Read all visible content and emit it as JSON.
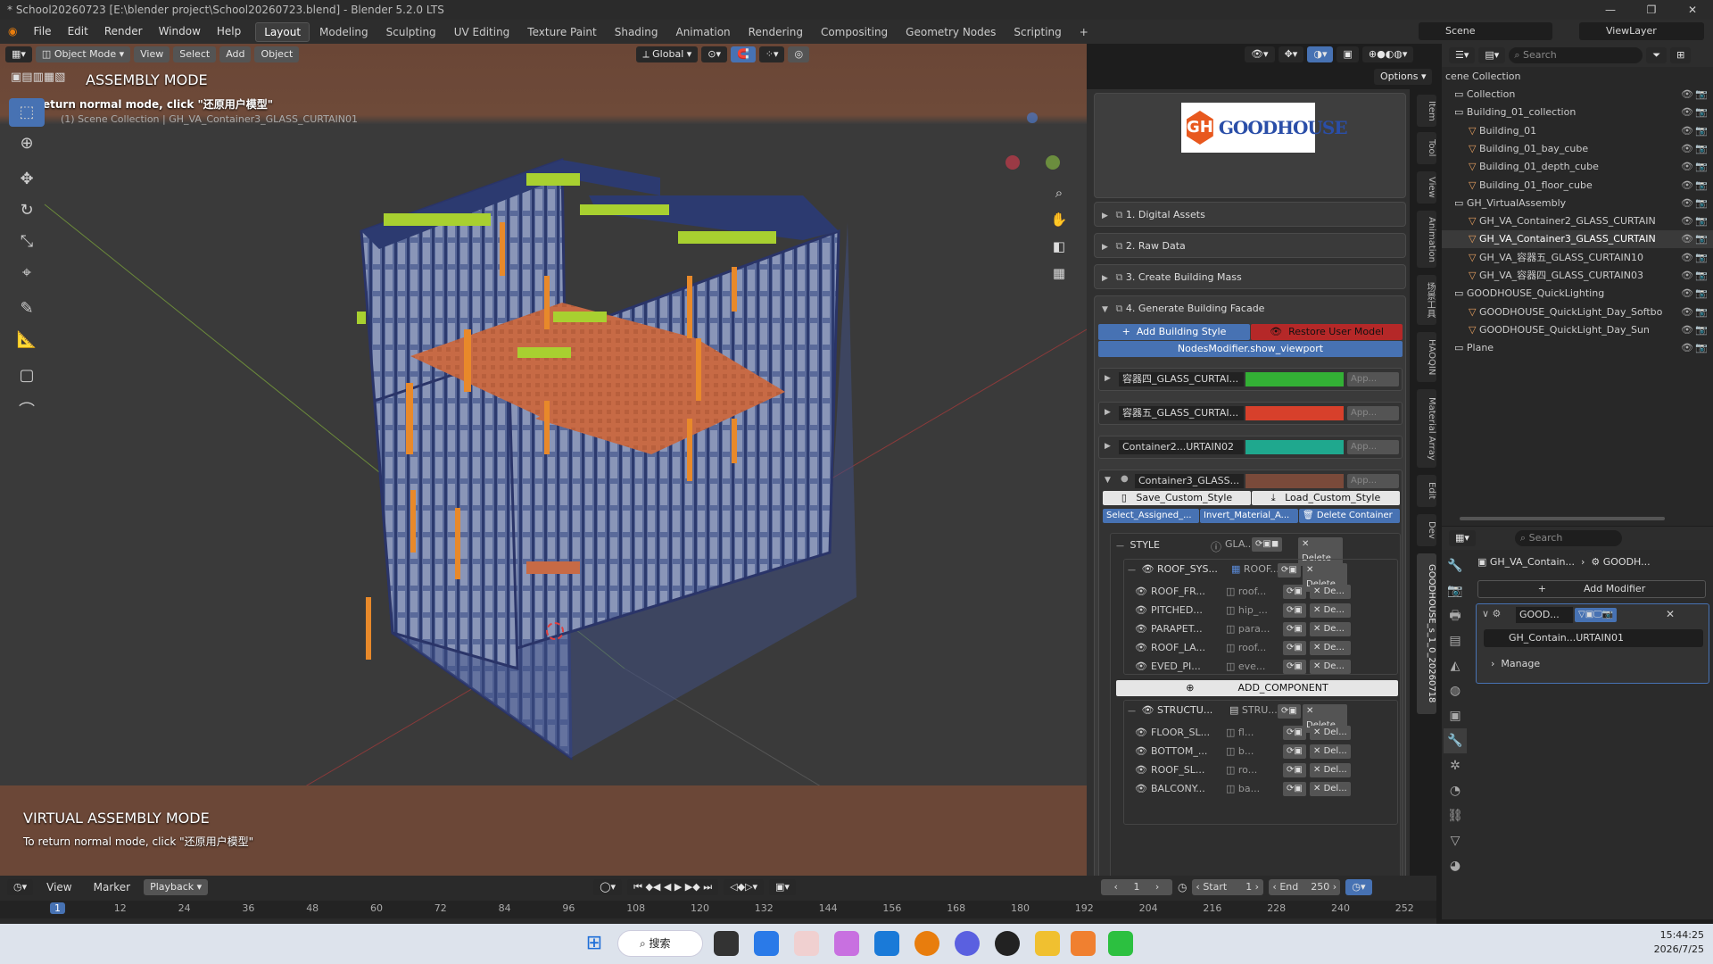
{
  "window": {
    "title": "* School20260723 [E:\\blender project\\School20260723.blend] - Blender 5.2.0 LTS"
  },
  "menu": [
    "File",
    "Edit",
    "Render",
    "Window",
    "Help"
  ],
  "workspaces": [
    "Layout",
    "Modeling",
    "Sculpting",
    "UV Editing",
    "Texture Paint",
    "Shading",
    "Animation",
    "Rendering",
    "Compositing",
    "Geometry Nodes",
    "Scripting"
  ],
  "scene": {
    "name": "Scene",
    "viewlayer": "ViewLayer",
    "search_placeholder": "Search"
  },
  "viewport": {
    "mode": "Object Mode",
    "menus": [
      "View",
      "Select",
      "Add",
      "Object"
    ],
    "transform": "Global",
    "options": "Options",
    "top_heading": "ASSEMBLY MODE",
    "top_hint": "eturn normal mode, click  \"还原用户模型\"",
    "collection_path": "(1) Scene Collection | GH_VA_Container3_GLASS_CURTAIN01",
    "bottom_heading": "VIRTUAL ASSEMBLY MODE",
    "bottom_hint": "To return normal mode, click  \"还原用户模型\""
  },
  "side_tabs": [
    "Item",
    "Tool",
    "View",
    "Animation",
    "场景工具",
    "HAOQIN",
    "Material Array",
    "Edit",
    "Dev",
    "GOODHOUSE_s_1_0_20260718"
  ],
  "goodhouse": {
    "logo_text": "GOODHOUSE",
    "logo_mark": "GH",
    "sections": [
      "1. Digital Assets",
      "2. Raw Data",
      "3. Create Building Mass",
      "4. Generate Building Facade"
    ],
    "add_style": "Add Building Style",
    "restore": "Restore User Model",
    "nodes_modifier": "NodesModifier.show_viewport",
    "containers": [
      {
        "name": "容器四_GLASS_CURTAI...",
        "color": "#33b035",
        "apply": "App..."
      },
      {
        "name": "容器五_GLASS_CURTAI...",
        "color": "#d7402b",
        "apply": "App..."
      },
      {
        "name": "Container2...URTAIN02",
        "color": "#1fa88e",
        "apply": "App..."
      },
      {
        "name": "Container3_GLASS...",
        "color": "#7a4a3a",
        "apply": "App..."
      }
    ],
    "save_style": "Save_Custom_Style",
    "load_style": "Load_Custom_Style",
    "select_assigned": "Select_Assigned_...",
    "invert_material": "Invert_Material_A...",
    "delete_container": "Delete Container",
    "style_label": "STYLE",
    "style_value": "GLA...",
    "delete": "Delete",
    "roof_sys": "ROOF_SYS...",
    "roof_sys_value": "ROOF...",
    "roof_items": [
      {
        "name": "ROOF_FR...",
        "value": "roof...",
        "del": "De..."
      },
      {
        "name": "PITCHED...",
        "value": "hip_...",
        "del": "De..."
      },
      {
        "name": "PARAPET...",
        "value": "para...",
        "del": "De..."
      },
      {
        "name": "ROOF_LA...",
        "value": "roof...",
        "del": "De..."
      },
      {
        "name": "EVED_PI...",
        "value": "eve...",
        "del": "De..."
      }
    ],
    "add_component": "ADD_COMPONENT",
    "structure": "STRUCTU...",
    "structure_value": "STRU...",
    "struct_items": [
      {
        "name": "FLOOR_SL...",
        "value": "fl...",
        "del": "Del..."
      },
      {
        "name": "BOTTOM_...",
        "value": "b...",
        "del": "Del..."
      },
      {
        "name": "ROOF_SL...",
        "value": "ro...",
        "del": "Del..."
      },
      {
        "name": "BALCONY...",
        "value": "ba...",
        "del": "Del..."
      }
    ]
  },
  "outliner": {
    "root": "cene Collection",
    "rows": [
      {
        "label": "Collection",
        "indent": 0
      },
      {
        "label": "Building_01_collection",
        "indent": 0
      },
      {
        "label": "Building_01",
        "indent": 1
      },
      {
        "label": "Building_01_bay_cube",
        "indent": 1
      },
      {
        "label": "Building_01_depth_cube",
        "indent": 1
      },
      {
        "label": "Building_01_floor_cube",
        "indent": 1
      },
      {
        "label": "GH_VirtualAssembly",
        "indent": 0
      },
      {
        "label": "GH_VA_Container2_GLASS_CURTAIN",
        "indent": 1
      },
      {
        "label": "GH_VA_Container3_GLASS_CURTAIN",
        "indent": 1
      },
      {
        "label": "GH_VA_容器五_GLASS_CURTAIN10",
        "indent": 1
      },
      {
        "label": "GH_VA_容器四_GLASS_CURTAIN03",
        "indent": 1
      },
      {
        "label": "GOODHOUSE_QuickLighting",
        "indent": 0
      },
      {
        "label": "GOODHOUSE_QuickLight_Day_Softbo",
        "indent": 1
      },
      {
        "label": "GOODHOUSE_QuickLight_Day_Sun",
        "indent": 1
      },
      {
        "label": "Plane",
        "indent": 0
      }
    ]
  },
  "properties": {
    "search_placeholder": "Search",
    "object": "GH_VA_Contain...",
    "modifier_owner": "GOODH...",
    "add_modifier": "Add Modifier",
    "modifier_name": "GOOD...",
    "node_group": "GH_Contain...URTAIN01",
    "manage": "Manage"
  },
  "timeline": {
    "menus": [
      "View",
      "Marker",
      "Playback"
    ],
    "current_frame": "1",
    "start_label": "Start",
    "start": "1",
    "end_label": "End",
    "end": "250",
    "ticks": [
      "1",
      "12",
      "24",
      "36",
      "48",
      "60",
      "72",
      "84",
      "96",
      "108",
      "120",
      "132",
      "144",
      "156",
      "168",
      "180",
      "192",
      "204",
      "216",
      "228",
      "240",
      "252"
    ]
  },
  "taskbar": {
    "search": "搜索",
    "time": "15:44:25",
    "date": "2026/7/25"
  }
}
